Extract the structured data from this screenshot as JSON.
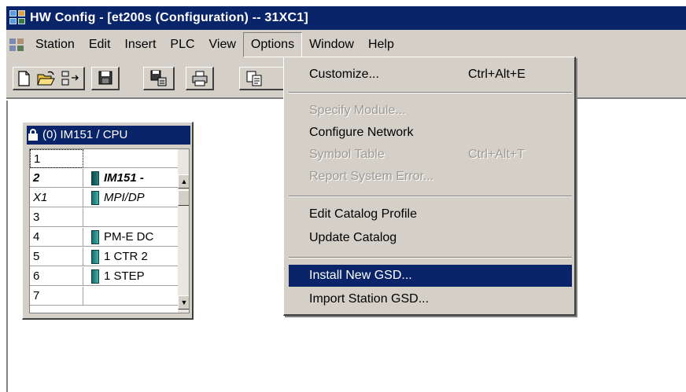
{
  "window": {
    "title": "HW Config - [et200s (Configuration) -- 31XC1]"
  },
  "menubar": {
    "items": [
      {
        "label": "Station"
      },
      {
        "label": "Edit"
      },
      {
        "label": "Insert"
      },
      {
        "label": "PLC"
      },
      {
        "label": "View"
      },
      {
        "label": "Options"
      },
      {
        "label": "Window"
      },
      {
        "label": "Help"
      }
    ],
    "active": "Options"
  },
  "toolbar": {
    "icons": [
      "new-icon",
      "open-icon",
      "download-icon",
      "save-icon",
      "compile-icon",
      "print-icon",
      "copy-icon"
    ]
  },
  "rack": {
    "title": "(0) IM151 / CPU",
    "rows": [
      {
        "slot": "1",
        "module": ""
      },
      {
        "slot": "2",
        "module": "IM151 -"
      },
      {
        "slot": "X1",
        "module": "MPI/DP"
      },
      {
        "slot": "3",
        "module": ""
      },
      {
        "slot": "4",
        "module": "PM-E DC"
      },
      {
        "slot": "5",
        "module": "1 CTR 2"
      },
      {
        "slot": "6",
        "module": "1 STEP"
      },
      {
        "slot": "7",
        "module": ""
      }
    ]
  },
  "options_menu": {
    "items": [
      {
        "label": "Customize...",
        "shortcut": "Ctrl+Alt+E",
        "enabled": true
      },
      {
        "label": "Specify Module...",
        "shortcut": "",
        "enabled": false
      },
      {
        "label": "Configure Network",
        "shortcut": "",
        "enabled": true
      },
      {
        "label": "Symbol Table",
        "shortcut": "Ctrl+Alt+T",
        "enabled": false
      },
      {
        "label": "Report System Error...",
        "shortcut": "",
        "enabled": false
      },
      {
        "label": "Edit Catalog Profile",
        "shortcut": "",
        "enabled": true
      },
      {
        "label": "Update Catalog",
        "shortcut": "",
        "enabled": true
      },
      {
        "label": "Install New GSD...",
        "shortcut": "",
        "enabled": true,
        "highlighted": true
      },
      {
        "label": "Import Station GSD...",
        "shortcut": "",
        "enabled": true
      }
    ]
  },
  "colors": {
    "titlebar": "#0a246a",
    "face": "#d4d0c8",
    "highlight": "#0a246a",
    "module_icon": "#2a8c88"
  }
}
